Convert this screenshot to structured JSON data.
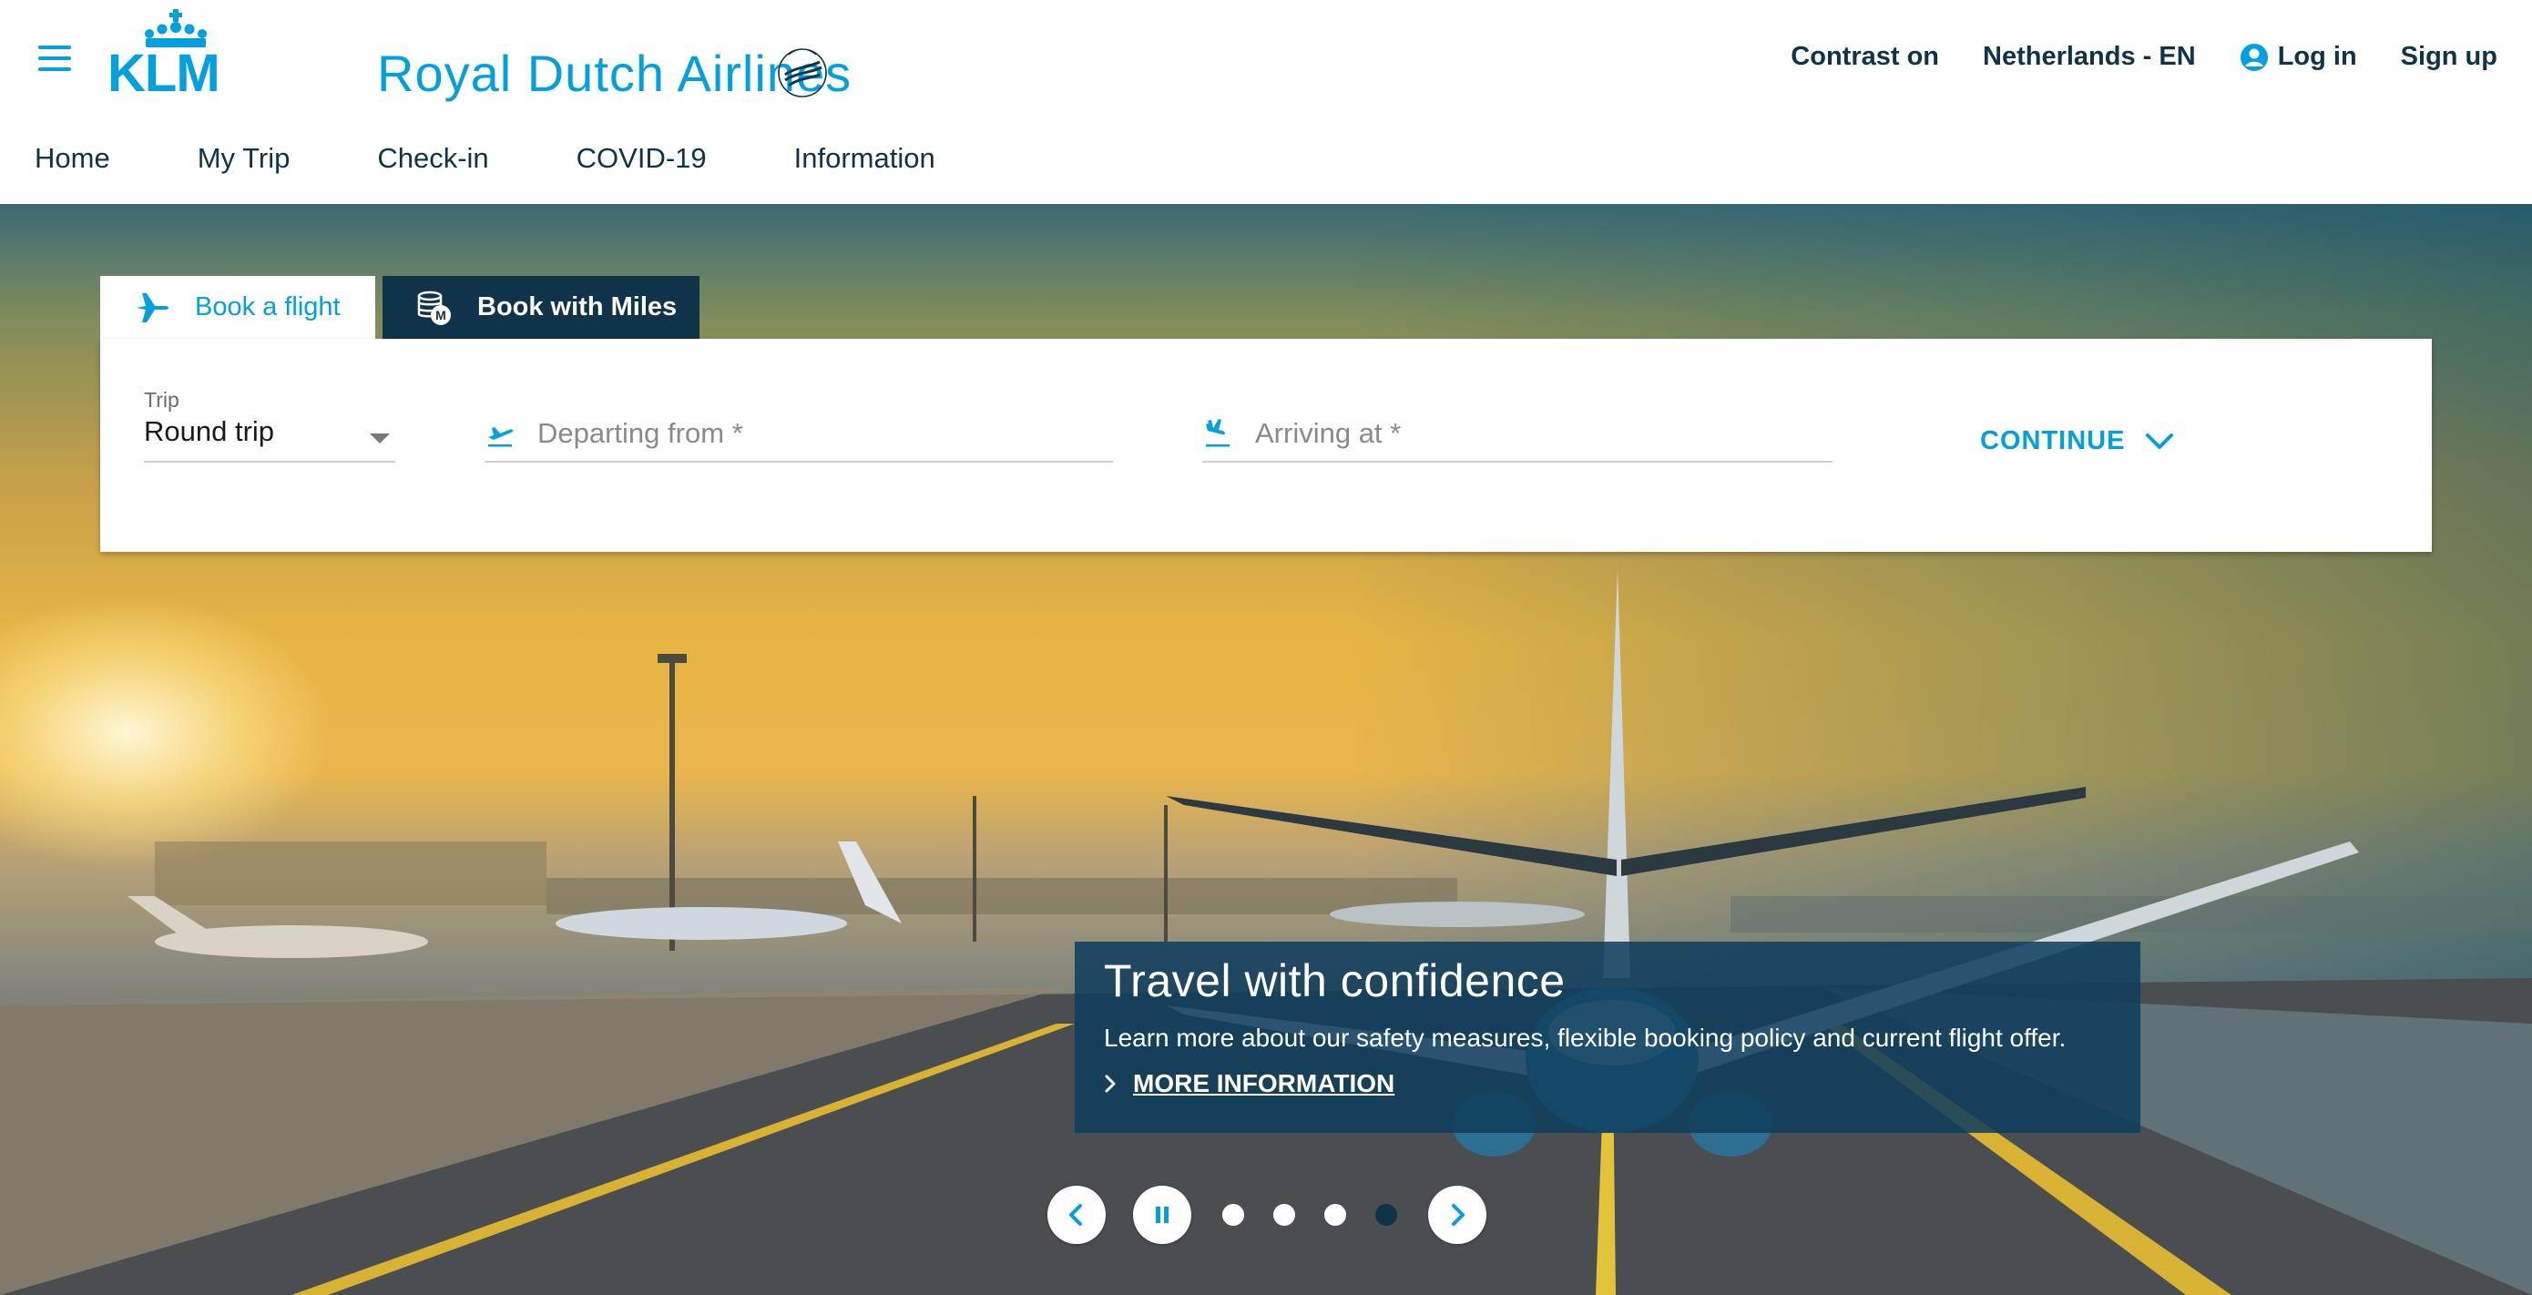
{
  "header": {
    "brand": "KLM",
    "airline_name": "Royal Dutch Airlines",
    "top_links": {
      "contrast": "Contrast on",
      "country": "Netherlands - EN",
      "login": "Log in",
      "signup": "Sign up"
    },
    "nav": [
      "Home",
      "My Trip",
      "Check-in",
      "COVID-19",
      "Information"
    ]
  },
  "booking": {
    "tabs": {
      "book_flight": "Book a flight",
      "book_miles": "Book with Miles",
      "active": "book_flight"
    },
    "trip_label": "Trip",
    "trip_value": "Round trip",
    "departing_placeholder": "Departing from *",
    "arriving_placeholder": "Arriving at *",
    "continue_label": "CONTINUE"
  },
  "promo": {
    "title": "Travel with confidence",
    "text": "Learn more about our safety measures, flexible booking policy and current flight offer.",
    "link": "MORE INFORMATION"
  },
  "carousel": {
    "slides": 4,
    "active_slide": 4
  },
  "colors": {
    "brand_blue": "#00a1de",
    "navy": "#0f3348"
  },
  "icons": {
    "menu": "hamburger-menu-icon",
    "crown": "crown-icon",
    "skyteam": "skyteam-logo-icon",
    "user": "user-icon",
    "plane": "plane-icon",
    "miles": "miles-coins-icon",
    "takeoff": "takeoff-icon",
    "landing": "landing-icon",
    "chevron_down": "chevron-down-icon",
    "chevron_right": "chevron-right-icon",
    "prev": "chevron-left-icon",
    "pause": "pause-icon",
    "next": "chevron-right-icon"
  }
}
